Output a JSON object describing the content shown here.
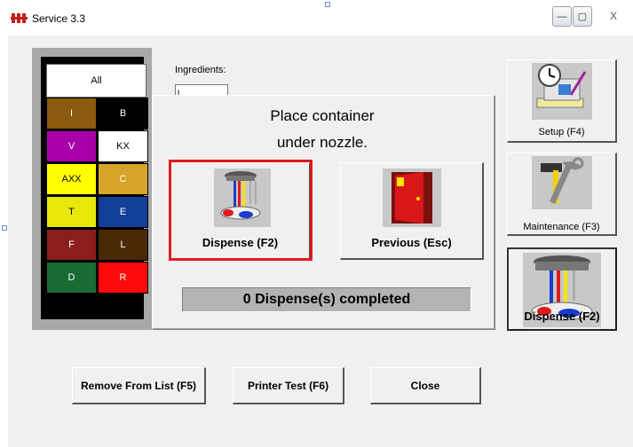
{
  "window": {
    "title": "Service 3.3",
    "minimize_glyph": "—",
    "maximize_glyph": "▢",
    "close_glyph": "X"
  },
  "palette": {
    "all_label": "All",
    "swatches": [
      {
        "label": "I",
        "color": "#8c5a0e",
        "text_color": "#ffffff"
      },
      {
        "label": "B",
        "color": "#000000",
        "text_color": "#ffffff"
      },
      {
        "label": "V",
        "color": "#a800a8",
        "text_color": "#ffffff"
      },
      {
        "label": "KX",
        "color": "#ffffff",
        "text_color": "#000000"
      },
      {
        "label": "AXX",
        "color": "#ffff00",
        "text_color": "#000000"
      },
      {
        "label": "C",
        "color": "#d6a52a",
        "text_color": "#ffffff"
      },
      {
        "label": "T",
        "color": "#e8e80a",
        "text_color": "#000000"
      },
      {
        "label": "E",
        "color": "#113f9a",
        "text_color": "#ffffff"
      },
      {
        "label": "F",
        "color": "#8a1e1e",
        "text_color": "#ffffff"
      },
      {
        "label": "L",
        "color": "#4a2a06",
        "text_color": "#ffffff"
      },
      {
        "label": "D",
        "color": "#1a6a34",
        "text_color": "#ffffff"
      },
      {
        "label": "R",
        "color": "#ff0a0a",
        "text_color": "#ffffff"
      }
    ]
  },
  "ingredients": {
    "label": "Ingredients:",
    "value": "l"
  },
  "dialog": {
    "line1": "Place container",
    "line2": "under nozzle.",
    "dispense_label": "Dispense (F2)",
    "previous_label": "Previous (Esc)",
    "status": "0 Dispense(s) completed",
    "highlight_color": "#e0191c"
  },
  "side_buttons": {
    "setup_label": "Setup (F4)",
    "maintenance_label": "Maintenance (F3)",
    "dispense_label": "Dispense (F2)"
  },
  "bottom_buttons": {
    "remove_label": "Remove From List (F5)",
    "printer_label": "Printer Test (F6)",
    "close_label": "Close"
  }
}
